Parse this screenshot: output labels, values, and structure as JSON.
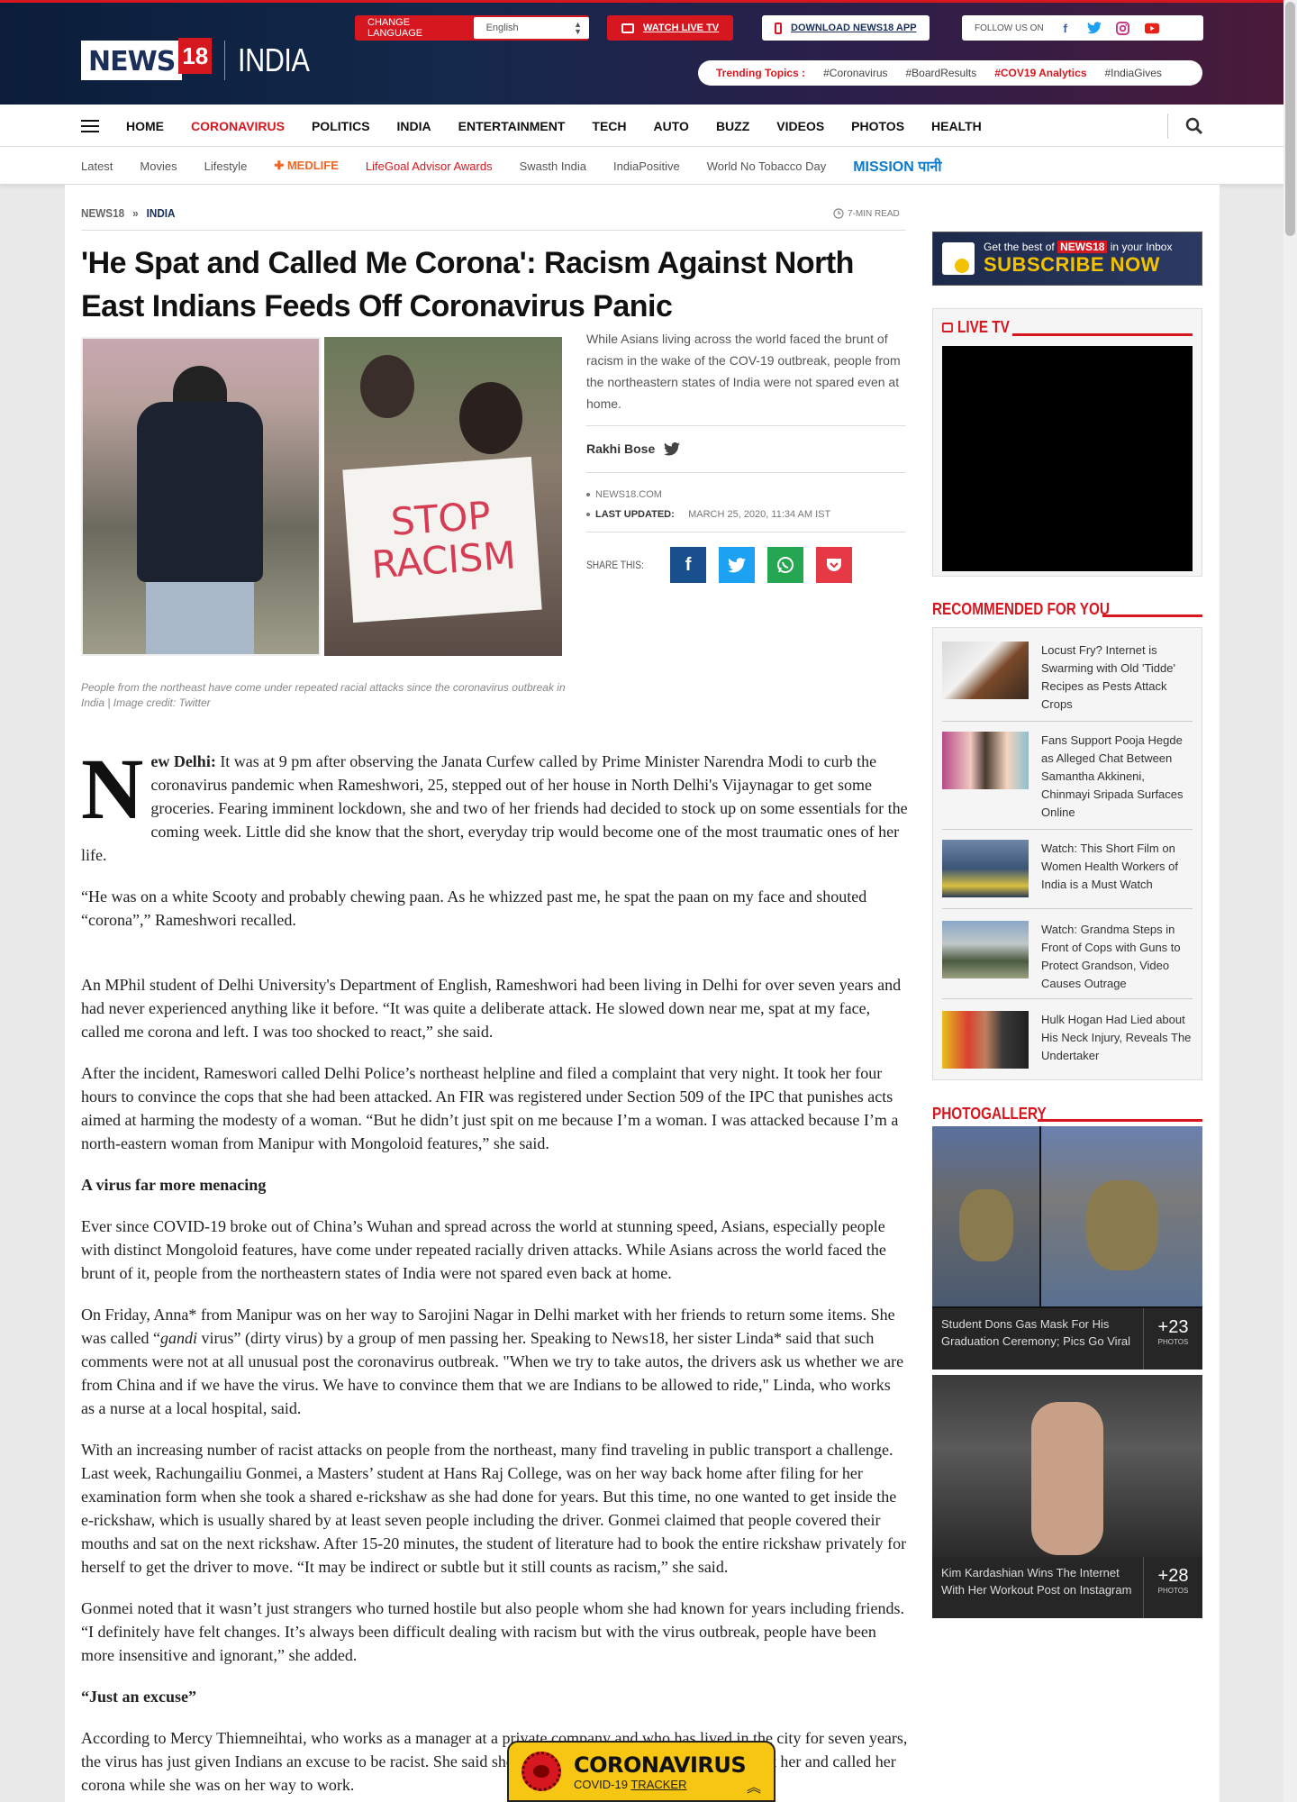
{
  "header": {
    "logo_news": "NEWS",
    "logo_18": "18",
    "logo_section": "INDIA",
    "change_language_label": "CHANGE LANGUAGE",
    "language_value": "English",
    "watch_live_tv": "WATCH LIVE TV",
    "download_app": "DOWNLOAD NEWS18 APP",
    "follow_us": "FOLLOW US ON",
    "trending_label": "Trending Topics :",
    "trending": [
      "#Coronavirus",
      "#BoardResults",
      "#COV19 Analytics",
      "#IndiaGives"
    ]
  },
  "nav": {
    "items": [
      "HOME",
      "CORONAVIRUS",
      "POLITICS",
      "INDIA",
      "ENTERTAINMENT",
      "TECH",
      "AUTO",
      "BUZZ",
      "VIDEOS",
      "PHOTOS",
      "HEALTH"
    ],
    "active": "CORONAVIRUS"
  },
  "subnav": {
    "items": [
      "Latest",
      "Movies",
      "Lifestyle"
    ],
    "medlife": "MEDLIFE",
    "lifegoal": "LifeGoal Advisor Awards",
    "items2": [
      "Swasth India",
      "IndiaPositive",
      "World No Tobacco Day"
    ],
    "mission": "MISSION पानी"
  },
  "breadcrumb": [
    "NEWS18",
    "INDIA"
  ],
  "read_time": "7-MIN READ",
  "article": {
    "headline": "'He Spat and Called Me Corona': Racism Against North East Indians Feeds Off Coronavirus Panic",
    "sign_text_1": "STOP",
    "sign_text_2": "RACISM",
    "caption": "People from the northeast have come under repeated racial attacks since the coronavirus outbreak in India | Image credit: Twitter",
    "summary": "While Asians living across the world faced the brunt of racism in the wake of the COV-19 outbreak, people from the northeastern states of India were not spared even at home.",
    "author": "Rakhi Bose",
    "source": "NEWS18.COM",
    "last_updated_label": "LAST UPDATED:",
    "last_updated": "MARCH 25, 2020, 11:34 AM IST",
    "share_label": "SHARE THIS:",
    "dropcap": "N",
    "p1_lead": "ew Delhi:",
    "p1": " It was at 9 pm after observing the Janata Curfew called by Prime Minister Narendra Modi to curb the coronavirus pandemic when Rameshwori, 25, stepped out of her house in North Delhi's Vijaynagar to get some groceries. Fearing imminent lockdown, she and two of her friends had decided to stock up on some essentials for the coming week. Little did she know that the short, everyday trip would become one of the most traumatic ones of her life.",
    "p2": "“He was on a white Scooty and probably chewing paan. As he whizzed past me, he spat the paan on my face and shouted “corona”,” Rameshwori recalled.",
    "p3": "An MPhil student of Delhi University's Department of English, Rameshwori had been living in Delhi for over seven years and had never experienced anything like it before. “It was quite a deliberate attack. He slowed down near me, spat at my face, called me corona and left. I was too shocked to react,” she said.",
    "p4": "After the incident, Rameswori called Delhi Police’s northeast helpline and filed a complaint that very night. It took her four hours to convince the cops that she had been attacked. An FIR was registered under Section 509 of the IPC that punishes acts aimed at harming the modesty of a woman. “But he didn’t just spit on me because I’m a woman. I was attacked because I’m a north-eastern woman from Manipur with Mongoloid features,” she said.",
    "h1": "A virus far more menacing",
    "p5": "Ever since COVID-19 broke out of China’s Wuhan and spread across the world at stunning speed, Asians, especially people with distinct Mongoloid features, have come under repeated racially driven attacks. While Asians across the world faced the brunt of it, people from the northeastern states of India were not spared even back at home.",
    "p6a": "On Friday, Anna* from Manipur was on her way to Sarojini Nagar in Delhi market with her friends to return some items. She was called “",
    "p6i": "gandi",
    "p6b": " virus” (dirty virus) by a group of men passing her. Speaking to News18, her sister Linda* said that such comments were not at all unusual post the coronavirus outbreak. \"When we try to take autos, the drivers ask us whether we are from China and if we have the virus. We have to convince them that we are Indians to be allowed to ride,\" Linda, who works as a nurse at a local hospital, said.",
    "p7": "With an increasing number of racist attacks on people from the northeast, many find traveling in public transport a challenge. Last week, Rachungailiu Gonmei, a Masters’ student at Hans Raj College, was on her way back home after filing for her examination form when she took a shared e-rickshaw as she had done for years. But this time, no one wanted to get inside the e-rickshaw, which is usually shared by at least seven people including the driver. Gonmei claimed that people covered their mouths and sat on the next rickshaw. After 15-20 minutes, the student of literature had to book the entire rickshaw privately for herself to get the driver to move. “It may be indirect or subtle but it still counts as racism,” she said.",
    "p8": "Gonmei noted that it wasn’t just strangers who turned hostile but also people whom she had known for years including friends. “I definitely have felt changes. It’s always been difficult dealing with racism but with the virus outbreak, people have been more insensitive and ignorant,” she added.",
    "h2": "“Just an excuse”",
    "p9": "According to Mercy Thiemneihtai, who works as a manager at a private company and who has lived in the city for seven years, the virus has just given Indians an excuse to be racist. She said she was pushed by two boys who pointed at her and called her corona while she was on her way to work."
  },
  "sidebar": {
    "subscribe_line1_pre": "Get the best of",
    "subscribe_brand": "NEWS18",
    "subscribe_line1_post": "in your Inbox",
    "subscribe_cta": "SUBSCRIBE NOW",
    "live_tv_title": "LIVE TV",
    "recommended_title": "RECOMMENDED FOR YOU",
    "recommended": [
      "Locust Fry? Internet is Swarming with Old 'Tidde' Recipes as Pests Attack Crops",
      "Fans Support Pooja Hegde as Alleged Chat Between Samantha Akkineni, Chinmayi Sripada Surfaces Online",
      "Watch: This Short Film on Women Health Workers of India is a Must Watch",
      "Watch: Grandma Steps in Front of Cops with Guns to Protect Grandson, Video Causes Outrage",
      "Hulk Hogan Had Lied about His Neck Injury, Reveals The Undertaker"
    ],
    "photogallery_title": "PHOTOGALLERY",
    "photos": [
      {
        "title": "Student Dons Gas Mask For His Graduation Ceremony; Pics Go Viral",
        "count": "+23",
        "label": "PHOTOS"
      },
      {
        "title": "Kim Kardashian Wins The Internet With Her Workout Post on Instagram",
        "count": "+28",
        "label": "PHOTOS"
      }
    ]
  },
  "tracker": {
    "title": "CORONAVIRUS",
    "sub_pre": "COVID-19",
    "sub_link": "TRACKER"
  }
}
